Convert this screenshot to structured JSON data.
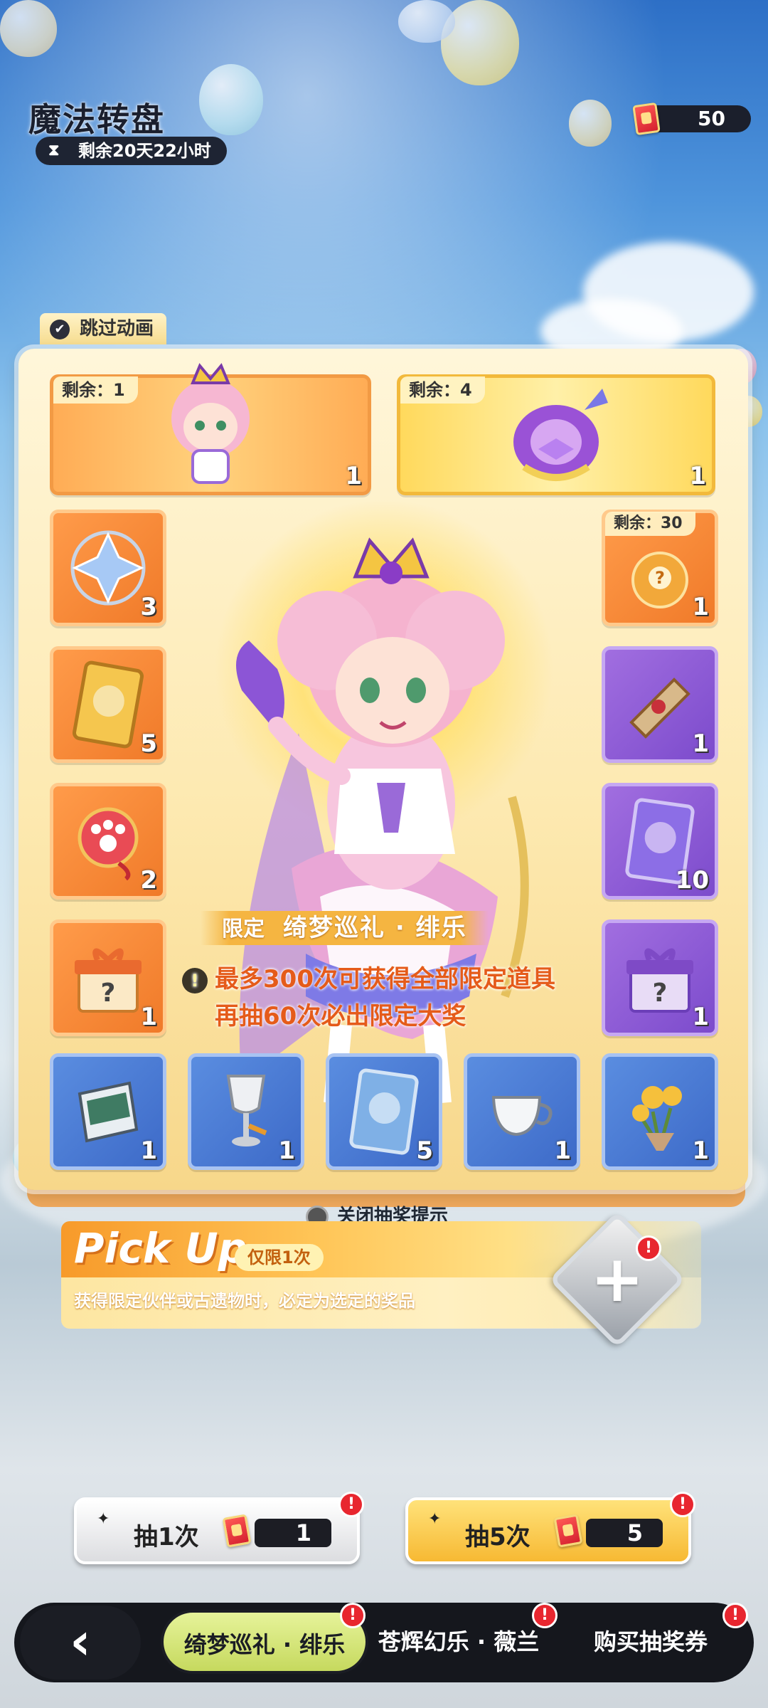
{
  "header": {
    "title": "魔法转盘",
    "timer": "剩余20天22小时",
    "currency": "50"
  },
  "skip_animation": "跳过动画",
  "top_rewards": [
    {
      "name": "chibi-character",
      "remaining": "剩余：1",
      "count": "1"
    },
    {
      "name": "crown-relic",
      "remaining": "剩余：4",
      "count": "1"
    }
  ],
  "left_items": [
    {
      "name": "crystal",
      "count": "3"
    },
    {
      "name": "gold-card",
      "count": "5"
    },
    {
      "name": "paw-compact",
      "count": "2"
    },
    {
      "name": "mystery-box-orange",
      "count": "1"
    }
  ],
  "right_items": [
    {
      "name": "potion-orb",
      "count": "1",
      "remaining": "剩余：30"
    },
    {
      "name": "scroll",
      "count": "1"
    },
    {
      "name": "purple-card",
      "count": "10"
    },
    {
      "name": "mystery-box-purple",
      "count": "1"
    }
  ],
  "bottom_items": [
    {
      "name": "book",
      "count": "1"
    },
    {
      "name": "goblet",
      "count": "1"
    },
    {
      "name": "blue-card",
      "count": "5"
    },
    {
      "name": "teacup",
      "count": "1"
    },
    {
      "name": "flower-bouquet",
      "count": "1"
    }
  ],
  "limited": {
    "tag": "限定",
    "name": "绮梦巡礼 · 绯乐"
  },
  "notice": {
    "line1": "最多300次可获得全部限定道具",
    "line2": "再抽60次必出限定大奖"
  },
  "close_hint": "关闭抽奖提示",
  "pickup": {
    "title": "Pick Up",
    "badge": "仅限1次",
    "desc": "获得限定伙伴或古遗物时，必定为选定的奖品",
    "badge_mark": "!"
  },
  "draw": {
    "one_label": "抽1次",
    "one_cost": "1",
    "five_label": "抽5次",
    "five_cost": "5",
    "mark": "!"
  },
  "nav": {
    "back": "‹",
    "tab1": "绮梦巡礼 · 绯乐",
    "tab2": "苍辉幻乐 · 薇兰",
    "tab3": "购买抽奖券",
    "mark": "!"
  },
  "colors": {
    "accent_orange": "#f07a29",
    "accent_purple": "#7c4bcc",
    "accent_blue": "#3d6ac8",
    "alert_red": "#e8262f",
    "warning_text": "#e55b1a"
  }
}
